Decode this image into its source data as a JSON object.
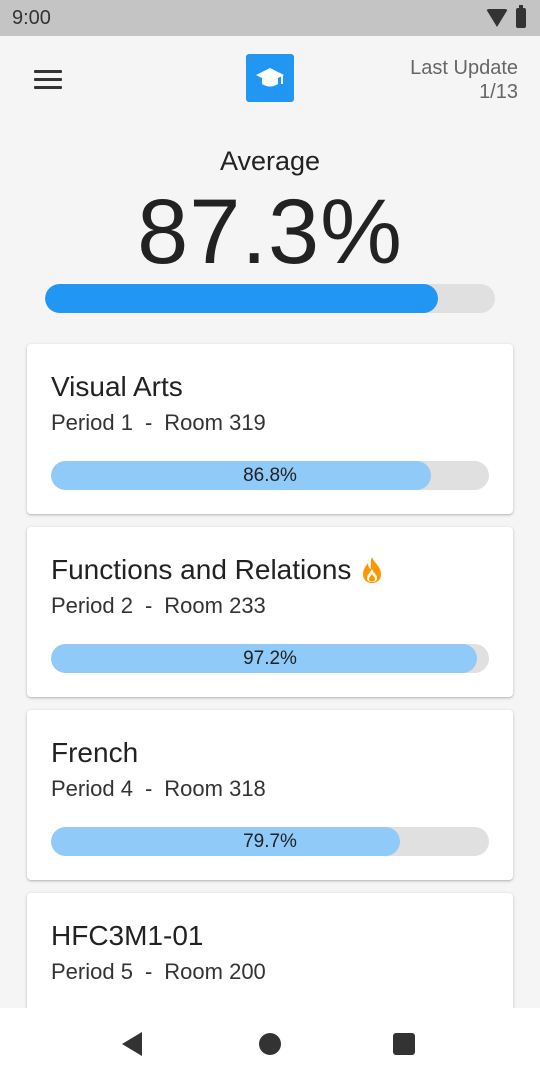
{
  "status_bar": {
    "time": "9:00",
    "icons": [
      "wifi-icon",
      "battery-icon"
    ]
  },
  "app_bar": {
    "menu_icon": "menu-icon",
    "logo_icon": "graduation-cap-icon",
    "last_update_label": "Last Update",
    "last_update_date": "1/13"
  },
  "average": {
    "label": "Average",
    "value_text": "87.3%",
    "value": 87.3
  },
  "courses": [
    {
      "name": "Visual Arts",
      "period": "Period 1",
      "room": "Room 319",
      "grade_text": "86.8%",
      "grade": 86.8,
      "hot": false
    },
    {
      "name": "Functions and Relations",
      "period": "Period 2",
      "room": "Room 233",
      "grade_text": "97.2%",
      "grade": 97.2,
      "hot": true
    },
    {
      "name": "French",
      "period": "Period 4",
      "room": "Room 318",
      "grade_text": "79.7%",
      "grade": 79.7,
      "hot": false
    },
    {
      "name": "HFC3M1-01",
      "period": "Period 5",
      "room": "Room 200",
      "grade_text": "",
      "grade": null,
      "hot": false
    }
  ],
  "separator": "-",
  "colors": {
    "accent": "#2196f3",
    "course_bar": "#90caf9",
    "track": "#e0e0e0",
    "fire": "#ff9800"
  },
  "nav_bar": {
    "icons": [
      "back-icon",
      "home-icon",
      "recents-icon"
    ]
  }
}
